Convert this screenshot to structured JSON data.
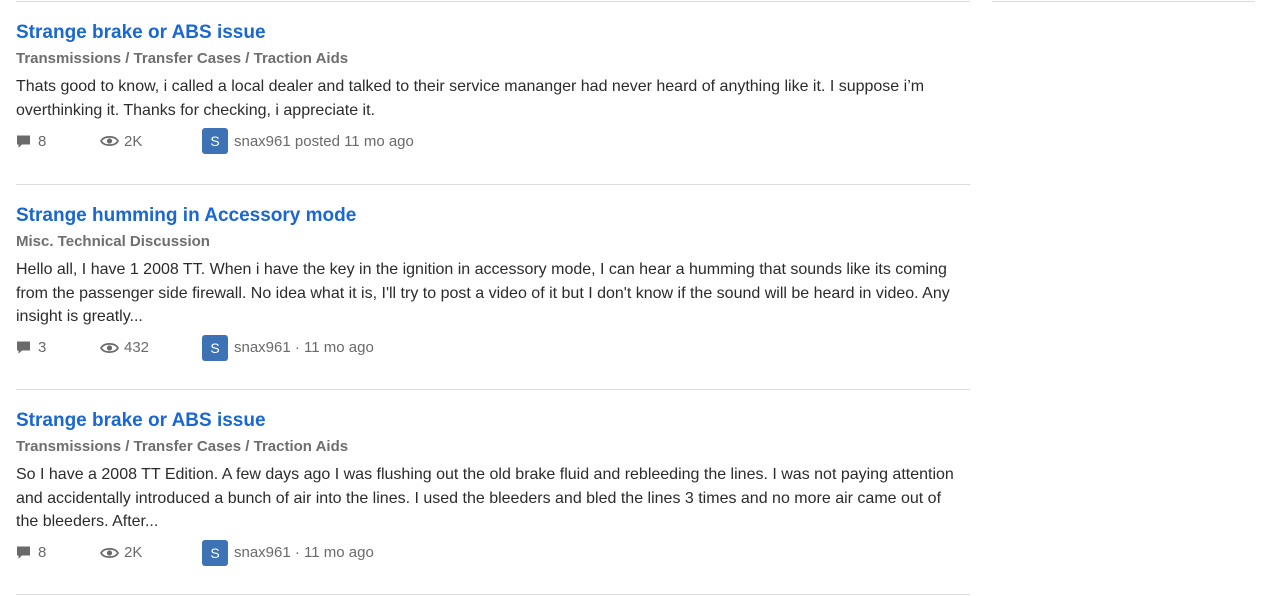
{
  "posts": [
    {
      "title": "Strange brake or ABS issue",
      "category": "Transmissions / Transfer Cases / Traction Aids",
      "excerpt": "Thats good to know, i called a local dealer and talked to their service mananger had never heard of anything like it. I suppose i’m overthinking it. Thanks for checking, i appreciate it.",
      "replies": "8",
      "views": "2K",
      "avatar_letter": "S",
      "author_line": "snax961 posted 11 mo ago"
    },
    {
      "title": "Strange humming in Accessory mode",
      "category": "Misc. Technical Discussion",
      "excerpt": "Hello all, I have 1 2008 TT. When i have the key in the ignition in accessory mode, I can hear a humming that sounds like its coming from the passenger side firewall. No idea what it is, I'll try to post a video of it but I don't know if the sound will be heard in video. Any insight is greatly...",
      "replies": "3",
      "views": "432",
      "avatar_letter": "S",
      "author_line": "snax961 · 11 mo ago"
    },
    {
      "title": "Strange brake or ABS issue",
      "category": "Transmissions / Transfer Cases / Traction Aids",
      "excerpt": "So I have a 2008 TT Edition. A few days ago I was flushing out the old brake fluid and rebleeding the lines. I was not paying attention and accidentally introduced a bunch of air into the lines. I used the bleeders and bled the lines 3 times and no more air came out of the bleeders. After...",
      "replies": "8",
      "views": "2K",
      "avatar_letter": "S",
      "author_line": "snax961 · 11 mo ago"
    }
  ],
  "colors": {
    "link": "#1967d2",
    "category": "#6e6e6e",
    "avatar_bg": "#3d72b4",
    "divider": "#dcdcdc"
  },
  "icons": {
    "replies": "comment-icon",
    "views": "eye-icon"
  }
}
